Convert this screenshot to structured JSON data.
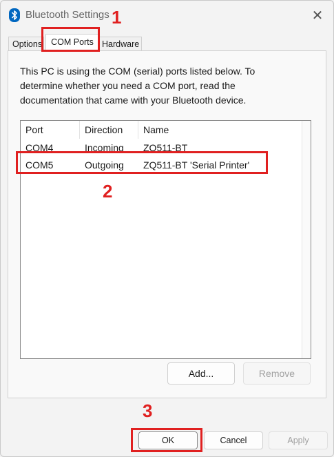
{
  "window": {
    "title": "Bluetooth Settings"
  },
  "tabs": [
    {
      "label": "Options"
    },
    {
      "label": "COM Ports"
    },
    {
      "label": "Hardware"
    }
  ],
  "panel": {
    "description": "This PC is using the COM (serial) ports listed below. To determine whether you need a COM port, read the documentation that came with your Bluetooth device."
  },
  "list": {
    "columns": [
      "Port",
      "Direction",
      "Name"
    ],
    "rows": [
      {
        "port": "COM4",
        "direction": "Incoming",
        "name": "ZQ511-BT"
      },
      {
        "port": "COM5",
        "direction": "Outgoing",
        "name": "ZQ511-BT 'Serial Printer'"
      }
    ]
  },
  "buttons": {
    "add": "Add...",
    "remove": "Remove",
    "ok": "OK",
    "cancel": "Cancel",
    "apply": "Apply"
  },
  "annotations": {
    "step1": "1",
    "step2": "2",
    "step3": "3"
  },
  "colors": {
    "annotation": "#e02020",
    "bluetooth_icon": "#0067c0"
  },
  "icons": {
    "bluetooth": "bluetooth-icon",
    "close": "close-icon"
  }
}
